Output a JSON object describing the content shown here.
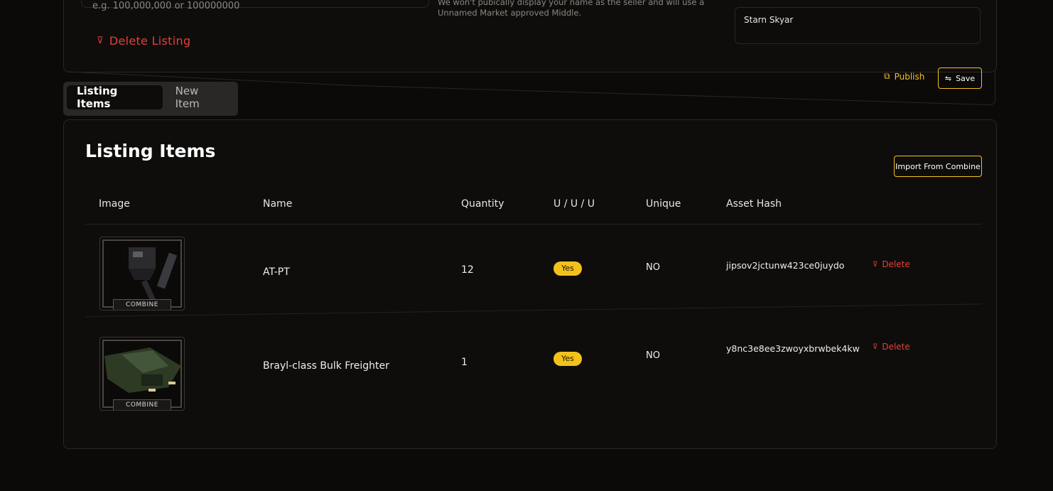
{
  "listing": {
    "price_hint": "e.g. 100,000,000 or 100000000",
    "delete_label": "Delete Listing",
    "middle_note": "We won't pubically display your name as the seller and will use a Unnamed Market approved Middle.",
    "seller_value": "Starn Skyar",
    "publish_label": "Publish",
    "save_label": "Save"
  },
  "tabs": [
    {
      "label": "Listing Items",
      "active": true
    },
    {
      "label": "New Item",
      "active": false
    }
  ],
  "items_section": {
    "title": "Listing Items",
    "import_label": "Import From Combine",
    "columns": [
      "Image",
      "Name",
      "Quantity",
      "U / U / U",
      "Unique",
      "Asset Hash"
    ],
    "rows": [
      {
        "image_brand": "COMBINE",
        "name": "AT-PT",
        "quantity": "12",
        "uuu": "Yes",
        "unique": "NO",
        "asset_hash": "jipsov2jctunw423ce0juydo",
        "delete_label": "Delete"
      },
      {
        "image_brand": "COMBINE",
        "name": "Brayl-class Bulk Freighter",
        "quantity": "1",
        "uuu": "Yes",
        "unique": "NO",
        "asset_hash": "y8nc3e8ee3zwoyxbrwbek4kw",
        "delete_label": "Delete"
      }
    ]
  },
  "colors": {
    "accent": "#f2c21b",
    "danger": "#e0413a",
    "background": "#0b0a09"
  },
  "icons": {
    "delete": "trash-icon",
    "publish": "publish-icon",
    "save": "save-icon"
  }
}
